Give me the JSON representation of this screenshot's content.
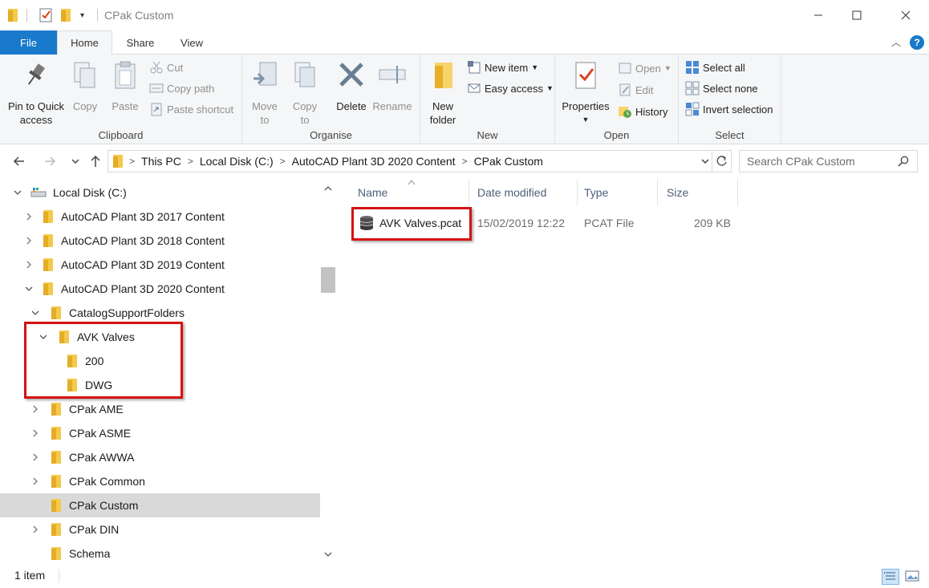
{
  "window": {
    "title": "CPak Custom"
  },
  "ribbon_tabs": [
    {
      "label": "File"
    },
    {
      "label": "Home"
    },
    {
      "label": "Share"
    },
    {
      "label": "View"
    }
  ],
  "ribbon": {
    "clipboard": {
      "pin": "Pin to Quick access",
      "pin_line1": "Pin to Quick",
      "pin_line2": "access",
      "copy": "Copy",
      "paste": "Paste",
      "cut": "Cut",
      "copy_path": "Copy path",
      "paste_shortcut": "Paste shortcut",
      "label": "Clipboard"
    },
    "organise": {
      "move_line1": "Move",
      "move_line2": "to",
      "copy_line1": "Copy",
      "copy_line2": "to",
      "delete": "Delete",
      "rename": "Rename",
      "label": "Organise"
    },
    "new": {
      "new_folder_line1": "New",
      "new_folder_line2": "folder",
      "new_item": "New item",
      "easy_access": "Easy access",
      "label": "New"
    },
    "open": {
      "properties": "Properties",
      "open": "Open",
      "edit": "Edit",
      "history": "History",
      "label": "Open"
    },
    "select": {
      "select_all": "Select all",
      "select_none": "Select none",
      "invert_selection": "Invert selection",
      "label": "Select"
    }
  },
  "address_bar": {
    "crumbs": [
      "This PC",
      "Local Disk (C:)",
      "AutoCAD Plant 3D 2020 Content",
      "CPak Custom"
    ]
  },
  "search": {
    "placeholder": "Search CPak Custom"
  },
  "tree": [
    {
      "label": "Local Disk (C:)",
      "chevron": "expanded",
      "icon": "drive-icon"
    },
    {
      "label": "AutoCAD Plant 3D 2017 Content",
      "chevron": "collapsed"
    },
    {
      "label": "AutoCAD Plant 3D 2018 Content",
      "chevron": "collapsed"
    },
    {
      "label": "AutoCAD Plant 3D 2019 Content",
      "chevron": "collapsed"
    },
    {
      "label": "AutoCAD Plant 3D 2020 Content",
      "chevron": "expanded"
    },
    {
      "label": "CatalogSupportFolders",
      "chevron": "expanded"
    },
    {
      "label": "AVK Valves",
      "chevron": "expanded"
    },
    {
      "label": "200",
      "chevron": "none"
    },
    {
      "label": "DWG",
      "chevron": "none"
    },
    {
      "label": "CPak AME",
      "chevron": "collapsed"
    },
    {
      "label": "CPak ASME",
      "chevron": "collapsed"
    },
    {
      "label": "CPak AWWA",
      "chevron": "collapsed"
    },
    {
      "label": "CPak Common",
      "chevron": "collapsed"
    },
    {
      "label": "CPak Custom",
      "chevron": "none",
      "selected": true
    },
    {
      "label": "CPak DIN",
      "chevron": "collapsed"
    },
    {
      "label": "Schema",
      "chevron": "none"
    }
  ],
  "columns": [
    "Name",
    "Date modified",
    "Type",
    "Size"
  ],
  "files": [
    {
      "name": "AVK Valves.pcat",
      "date_modified": "15/02/2019 12:22",
      "type": "PCAT File",
      "size": "209 KB"
    }
  ],
  "status": {
    "item_count": "1 item"
  },
  "colors": {
    "file_tab": "#1979ca",
    "highlight_box": "#d51212",
    "folder": "#f3c94e",
    "selection": "#d9d9d9"
  }
}
